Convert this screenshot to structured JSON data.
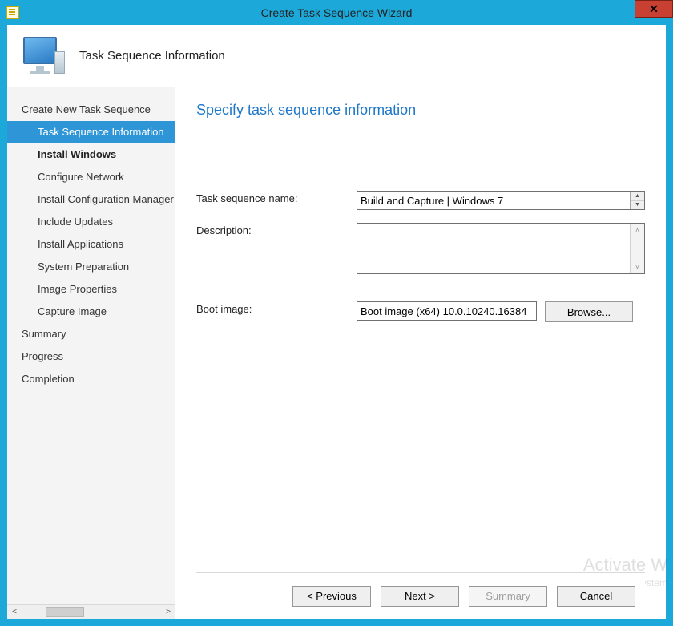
{
  "titlebar": {
    "title": "Create Task Sequence Wizard"
  },
  "header": {
    "title": "Task Sequence Information"
  },
  "sidebar": {
    "items": [
      {
        "label": "Create New Task Sequence",
        "indent": 0,
        "bold": false
      },
      {
        "label": "Task Sequence Information",
        "indent": 1,
        "selected": true
      },
      {
        "label": "Install Windows",
        "indent": 1,
        "bold": true
      },
      {
        "label": "Configure Network",
        "indent": 1
      },
      {
        "label": "Install Configuration Manager",
        "indent": 1
      },
      {
        "label": "Include Updates",
        "indent": 1
      },
      {
        "label": "Install Applications",
        "indent": 1
      },
      {
        "label": "System Preparation",
        "indent": 1
      },
      {
        "label": "Image Properties",
        "indent": 1
      },
      {
        "label": "Capture Image",
        "indent": 1
      },
      {
        "label": "Summary",
        "indent": 0
      },
      {
        "label": "Progress",
        "indent": 0
      },
      {
        "label": "Completion",
        "indent": 0
      }
    ]
  },
  "main": {
    "heading": "Specify task sequence information",
    "fields": {
      "task_name_label": "Task sequence name:",
      "task_name_value": "Build and Capture | Windows 7",
      "description_label": "Description:",
      "description_value": "",
      "boot_image_label": "Boot image:",
      "boot_image_value": "Boot image (x64) 10.0.10240.16384",
      "browse_label": "Browse..."
    }
  },
  "footer": {
    "previous": "< Previous",
    "next": "Next >",
    "summary": "Summary",
    "cancel": "Cancel"
  },
  "watermark": {
    "line1": "Activate W",
    "line2": "Go to System"
  }
}
